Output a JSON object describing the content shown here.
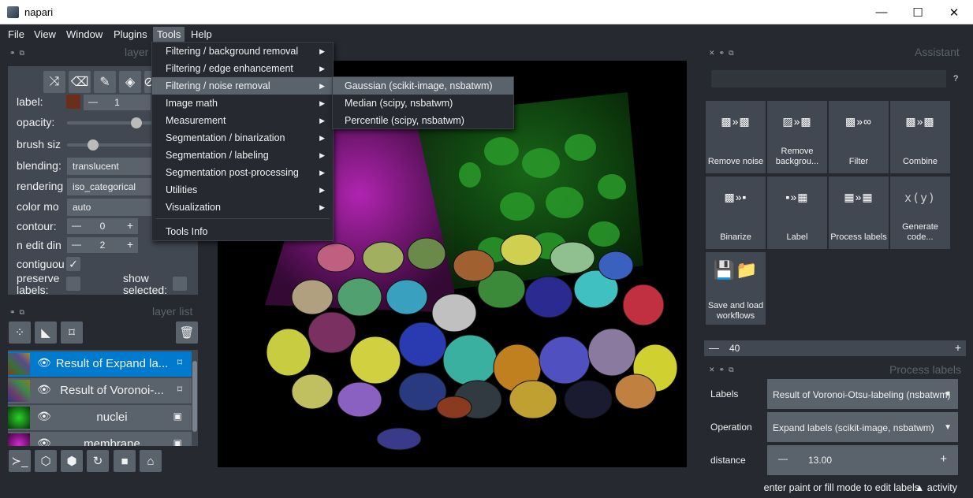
{
  "window": {
    "title": "napari",
    "minimize": "—",
    "maximize": "☐",
    "close": "✕"
  },
  "menubar": [
    "File",
    "View",
    "Window",
    "Plugins",
    "Tools",
    "Help"
  ],
  "panels": {
    "layer_controls": "layer",
    "layer_list": "layer list",
    "assistant": "Assistant",
    "process_labels": "Process labels"
  },
  "layer_controls": {
    "label_text": "label:",
    "label_value": "1",
    "opacity_text": "opacity:",
    "opacity": 0.8,
    "brush_text": "brush siz",
    "brush": 0.3,
    "blending_text": "blending:",
    "blending": "translucent",
    "rendering_text": "rendering",
    "rendering": "iso_categorical",
    "color_mode_text": "color mo",
    "color_mode": "auto",
    "contour_text": "contour:",
    "contour": "0",
    "n_edit_text": "n edit din",
    "n_edit": "2",
    "contiguous_text": "contiguou",
    "preserve_text": "preserve labels:",
    "show_selected_text": "show selected:",
    "label_color": "#6b2e1d"
  },
  "layers": [
    {
      "name": "Result of Expand la...",
      "selected": true
    },
    {
      "name": "Result of Voronoi-...",
      "selected": false
    },
    {
      "name": "nuclei",
      "selected": false
    },
    {
      "name": "membrane",
      "selected": false
    }
  ],
  "tools_menu": [
    {
      "label": "Filtering / background removal",
      "sub": true
    },
    {
      "label": "Filtering / edge enhancement",
      "sub": true
    },
    {
      "label": "Filtering / noise removal",
      "sub": true
    },
    {
      "label": "Image math",
      "sub": true
    },
    {
      "label": "Measurement",
      "sub": true
    },
    {
      "label": "Segmentation / binarization",
      "sub": true
    },
    {
      "label": "Segmentation / labeling",
      "sub": true
    },
    {
      "label": "Segmentation post-processing",
      "sub": true
    },
    {
      "label": "Utilities",
      "sub": true
    },
    {
      "label": "Visualization",
      "sub": true
    },
    {
      "label": "Tools Info",
      "sub": false
    }
  ],
  "noise_submenu": [
    "Gaussian (scikit-image, nsbatwm)",
    "Median (scipy, nsbatwm)",
    "Percentile (scipy, nsbatwm)"
  ],
  "assistant": {
    "help": "?",
    "tiles": [
      "Remove noise",
      "Remove backgrou...",
      "Filter",
      "Combine",
      "Binarize",
      "Label",
      "Process labels",
      "Generate code...",
      "Save and load workflows"
    ],
    "generate_icon": "x(y)",
    "zoom": "40"
  },
  "process_labels": {
    "labels_text": "Labels",
    "labels": "Result of Voronoi-Otsu-labeling (nsbatwm)",
    "operation_text": "Operation",
    "operation": "Expand labels (scikit-image, nsbatwm)",
    "distance_text": "distance",
    "distance": "13.00"
  },
  "status": {
    "message": "enter paint or fill mode to edit labels",
    "activity": "activity"
  }
}
